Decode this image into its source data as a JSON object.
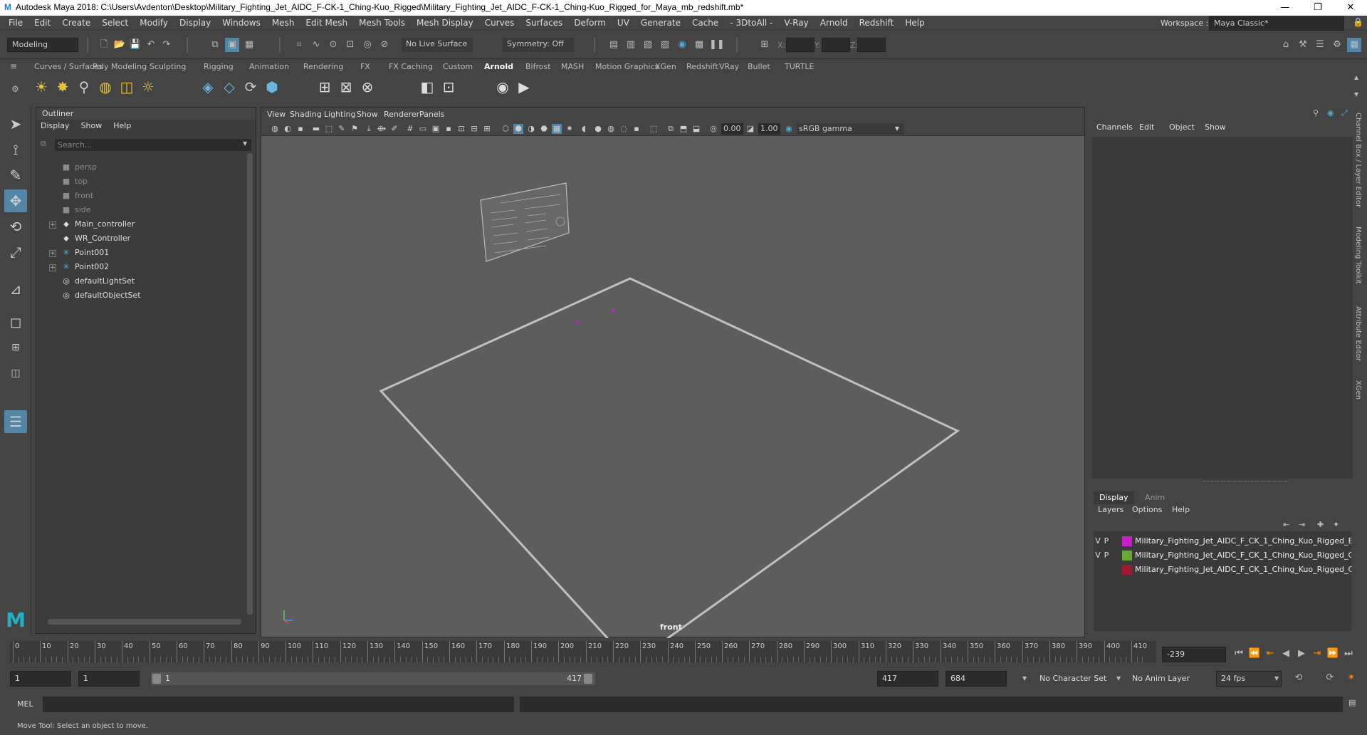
{
  "window": {
    "title": "Autodesk Maya 2018: C:\\Users\\Avdenton\\Desktop\\Military_Fighting_Jet_AIDC_F-CK-1_Ching-Kuo_Rigged\\Military_Fighting_Jet_AIDC_F-CK-1_Ching-Kuo_Rigged_for_Maya_mb_redshift.mb*",
    "minimize": "—",
    "maximize": "❐",
    "close": "✕"
  },
  "menubar": [
    "File",
    "Edit",
    "Create",
    "Select",
    "Modify",
    "Display",
    "Windows",
    "Mesh",
    "Edit Mesh",
    "Mesh Tools",
    "Mesh Display",
    "Curves",
    "Surfaces",
    "Deform",
    "UV",
    "Generate",
    "Cache",
    "- 3DtoAll -",
    "V-Ray",
    "Arnold",
    "Redshift",
    "Help"
  ],
  "workspace": {
    "label": "Workspace :",
    "value": "Maya Classic*"
  },
  "statusline": {
    "mode": "Modeling",
    "live_surface": "No Live Surface",
    "symmetry": "Symmetry: Off",
    "x_label": "X:",
    "y_label": "Y:",
    "z_label": "Z:"
  },
  "shelf_tabs": [
    "Curves / Surfaces",
    "Poly Modeling",
    "Sculpting",
    "Rigging",
    "Animation",
    "Rendering",
    "FX",
    "FX Caching",
    "Custom",
    "Arnold",
    "Bifrost",
    "MASH",
    "Motion Graphics",
    "XGen",
    "Redshift",
    "VRay",
    "Bullet",
    "TURTLE"
  ],
  "shelf_active": "Arnold",
  "outliner": {
    "title": "Outliner",
    "menu": [
      "Display",
      "Show",
      "Help"
    ],
    "search_placeholder": "Search...",
    "items": [
      {
        "label": "persp",
        "dim": true,
        "icon": "camera-icon"
      },
      {
        "label": "top",
        "dim": true,
        "icon": "camera-icon"
      },
      {
        "label": "front",
        "dim": true,
        "icon": "camera-icon"
      },
      {
        "label": "side",
        "dim": true,
        "icon": "camera-icon"
      },
      {
        "label": "Main_controller",
        "dim": false,
        "icon": "transform-icon",
        "expand": true
      },
      {
        "label": "WR_Controller",
        "dim": false,
        "icon": "transform-icon"
      },
      {
        "label": "Point001",
        "dim": false,
        "icon": "locator-icon",
        "expand": true
      },
      {
        "label": "Point002",
        "dim": false,
        "icon": "locator-icon",
        "expand": true
      },
      {
        "label": "defaultLightSet",
        "dim": false,
        "icon": "set-icon"
      },
      {
        "label": "defaultObjectSet",
        "dim": false,
        "icon": "set-icon"
      }
    ]
  },
  "viewport": {
    "menu": [
      "View",
      "Shading",
      "Lighting",
      "Show",
      "Renderer",
      "Panels"
    ],
    "field1": "0.00",
    "field2": "1.00",
    "color_space": "sRGB gamma",
    "camera_label": "front"
  },
  "channelbox": {
    "menu": [
      "Channels",
      "Edit",
      "Object",
      "Show"
    ],
    "layer_tabs": [
      "Display",
      "Anim"
    ],
    "layer_menu": [
      "Layers",
      "Options",
      "Help"
    ],
    "layers": [
      {
        "v": "V",
        "p": "P",
        "color": "#c81ec8",
        "name": "Military_Fighting_Jet_AIDC_F_CK_1_Ching_Kuo_Rigged_E"
      },
      {
        "v": "V",
        "p": "P",
        "color": "#6aa832",
        "name": "Military_Fighting_Jet_AIDC_F_CK_1_Ching_Kuo_Rigged_C"
      },
      {
        "v": "",
        "p": "",
        "color": "#a01a30",
        "name": "Military_Fighting_Jet_AIDC_F_CK_1_Ching_Kuo_Rigged_C"
      }
    ]
  },
  "side_tabs": [
    "Channel Box / Layer Editor",
    "Modeling Toolkit",
    "Attribute Editor",
    "XGen"
  ],
  "timeline": {
    "ticks": [
      0,
      10,
      20,
      30,
      40,
      50,
      60,
      70,
      80,
      90,
      100,
      110,
      120,
      130,
      140,
      150,
      160,
      170,
      180,
      190,
      200,
      210,
      220,
      230,
      240,
      250,
      260,
      270,
      280,
      290,
      300,
      310,
      320,
      330,
      340,
      350,
      360,
      370,
      380,
      390,
      400,
      410
    ],
    "current_frame": "-239"
  },
  "range": {
    "start": "1",
    "anim_start": "1",
    "range_start": "1",
    "range_end": "417",
    "anim_end": "417",
    "end": "684",
    "character_set": "No Character Set",
    "anim_layer": "No Anim Layer",
    "fps": "24 fps"
  },
  "cmdline": {
    "label": "MEL"
  },
  "helpline": "Move Tool: Select an object to move."
}
